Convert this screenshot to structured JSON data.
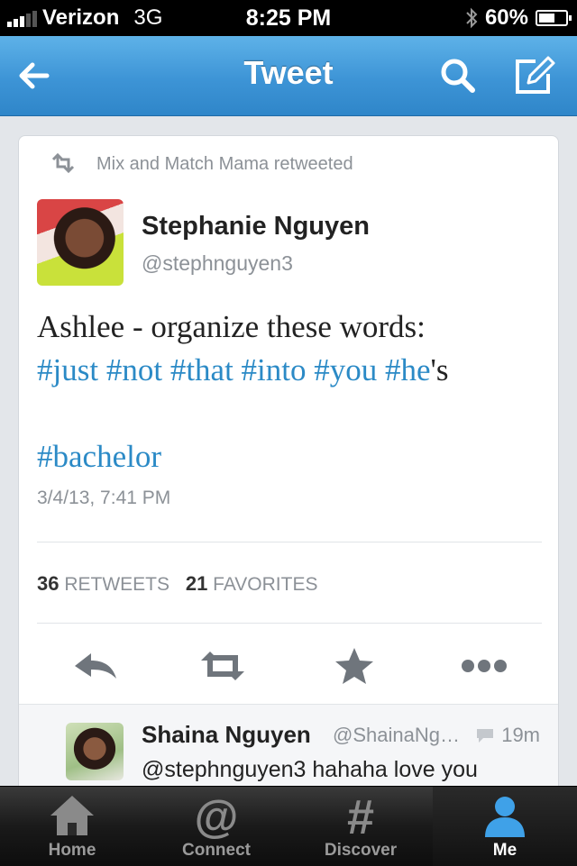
{
  "status_bar": {
    "carrier": "Verizon",
    "network": "3G",
    "time": "8:25 PM",
    "battery": "60%",
    "battery_level": 0.6
  },
  "nav": {
    "title": "Tweet",
    "back_icon": "back-arrow-icon",
    "search_icon": "search-icon",
    "compose_icon": "compose-icon"
  },
  "tweet": {
    "retweeted_by": "Mix and Match Mama retweeted",
    "author_name": "Stephanie Nguyen",
    "author_handle": "@stephnguyen3",
    "text_line1": "Ashlee - organize these words:",
    "hashtags": [
      "#just",
      "#not",
      "#that",
      "#into",
      "#you",
      "#he"
    ],
    "suffix": "'s",
    "last_hashtag": "#bachelor",
    "timestamp": "3/4/13, 7:41 PM",
    "retweet_count": "36",
    "retweet_label": "RETWEETS",
    "favorite_count": "21",
    "favorite_label": "FAVORITES",
    "link_color": "#2b8ac6"
  },
  "reply": {
    "author_name": "Shaina Nguyen",
    "author_handle": "@ShainaNg…",
    "time": "19m",
    "text": "@stephnguyen3 hahaha love you"
  },
  "tabs": [
    {
      "label": "Home",
      "icon": "home-icon"
    },
    {
      "label": "Connect",
      "icon": "at-icon"
    },
    {
      "label": "Discover",
      "icon": "hash-icon"
    },
    {
      "label": "Me",
      "icon": "person-icon",
      "active": true
    }
  ],
  "colors": {
    "nav_blue": "#3d94d6",
    "active_tab_icon": "#3fa1e8"
  }
}
